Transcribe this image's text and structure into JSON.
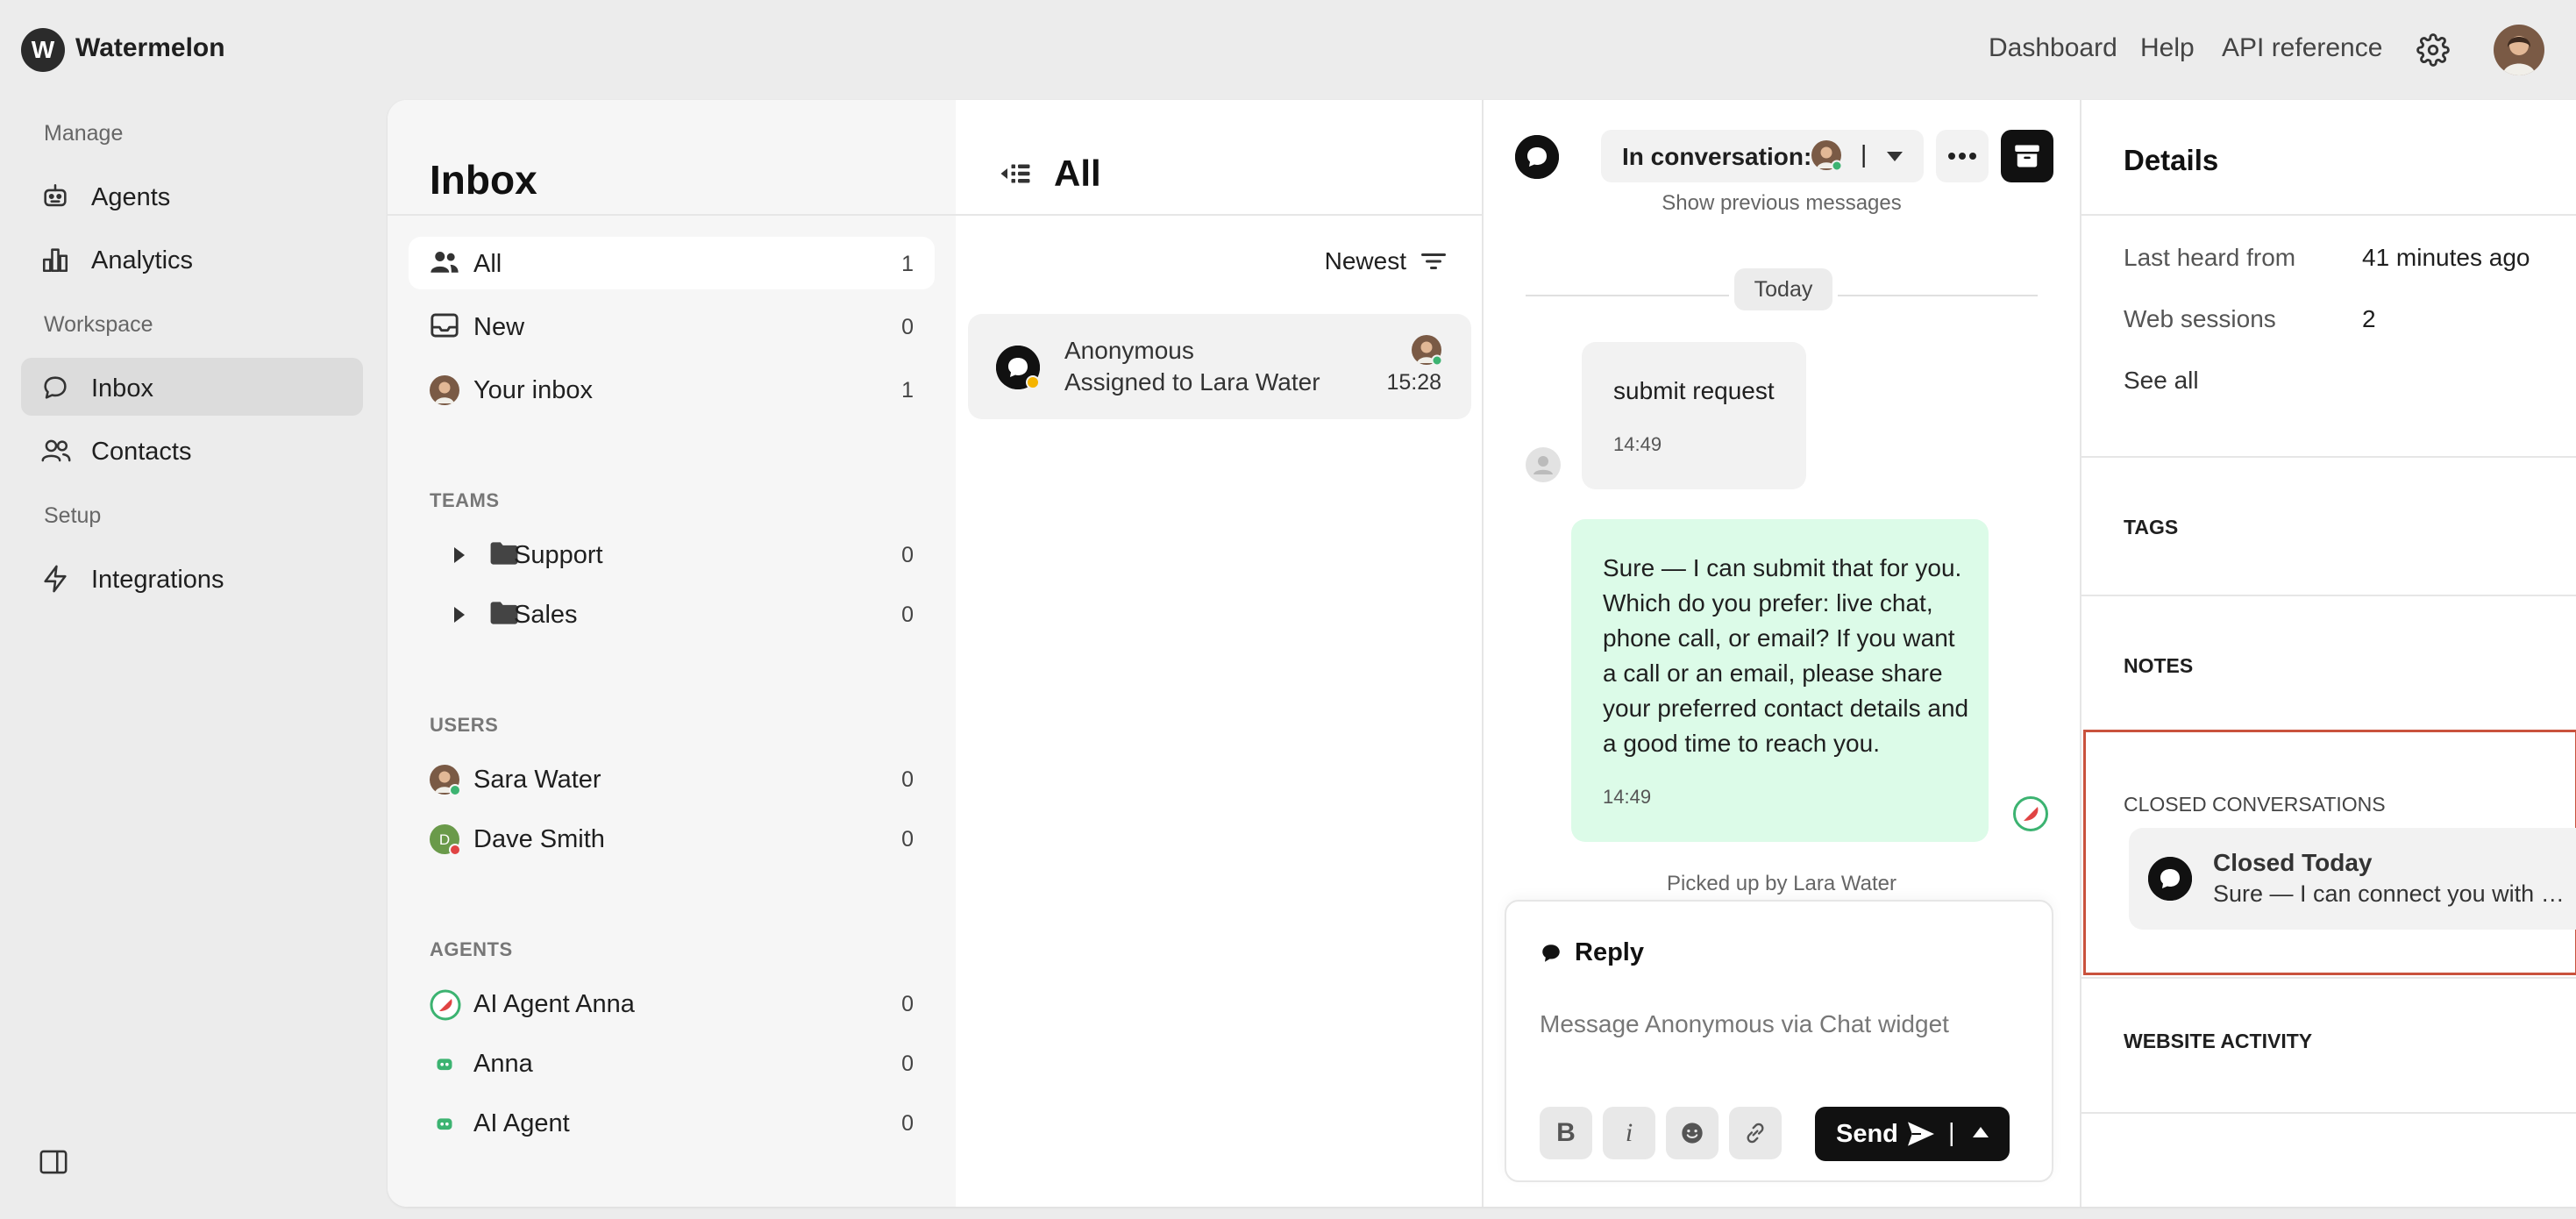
{
  "app": {
    "logo_letter": "W",
    "name": "Watermelon"
  },
  "topnav": {
    "dashboard": "Dashboard",
    "help": "Help",
    "api_reference": "API reference"
  },
  "sidebar": {
    "manage_label": "Manage",
    "workspace_label": "Workspace",
    "setup_label": "Setup",
    "items": {
      "agents": "Agents",
      "analytics": "Analytics",
      "inbox": "Inbox",
      "contacts": "Contacts",
      "integrations": "Integrations"
    }
  },
  "inbox": {
    "title": "Inbox",
    "rows": [
      {
        "label": "All",
        "count": "1"
      },
      {
        "label": "New",
        "count": "0"
      },
      {
        "label": "Your inbox",
        "count": "1"
      }
    ],
    "teams_label": "TEAMS",
    "teams": [
      {
        "label": "Support",
        "count": "0"
      },
      {
        "label": "Sales",
        "count": "0"
      }
    ],
    "users_label": "USERS",
    "users": [
      {
        "label": "Sara Water",
        "count": "0",
        "initial": ""
      },
      {
        "label": "Dave Smith",
        "count": "0",
        "initial": "D"
      }
    ],
    "agents_label": "AGENTS",
    "agents": [
      {
        "label": "AI Agent Anna",
        "count": "0"
      },
      {
        "label": "Anna",
        "count": "0"
      },
      {
        "label": "AI Agent",
        "count": "0"
      }
    ]
  },
  "list": {
    "title": "All",
    "sort_label": "Newest",
    "conversation": {
      "name": "Anonymous",
      "subtitle": "Assigned to Lara Water",
      "time": "15:28"
    }
  },
  "conversation": {
    "status_label": "In conversation:",
    "separator": "|",
    "previous_messages": "Show previous messages",
    "day_label": "Today",
    "messages": [
      {
        "text": "submit request",
        "time": "14:49"
      },
      {
        "text": "Sure — I can submit that for you. Which do you prefer: live chat, phone call, or email? If you want a call or an email, please share your preferred contact details and a good time to reach you.",
        "time": "14:49"
      }
    ],
    "handled_note": "Picked up by Lara Water",
    "reply": {
      "label": "Reply",
      "placeholder": "Message Anonymous via Chat widget",
      "bold": "B",
      "italic": "i",
      "send": "Send",
      "separator": "|"
    }
  },
  "details": {
    "title": "Details",
    "last_heard_label": "Last heard from",
    "last_heard_value": "41 minutes ago",
    "web_sessions_label": "Web sessions",
    "web_sessions_value": "2",
    "see_all": "See all",
    "tags_label": "TAGS",
    "notes_label": "NOTES",
    "closed_label": "CLOSED CONVERSATIONS",
    "closed_item": {
      "title": "Closed Today",
      "snippet": "Sure — I can connect you with a live agent"
    },
    "website_activity_label": "WEBSITE ACTIVITY"
  },
  "colors": {
    "accent_green": "#3cb371",
    "bubble_green": "#dcfbe8",
    "highlight": "#c9523d",
    "dark": "#111111"
  }
}
